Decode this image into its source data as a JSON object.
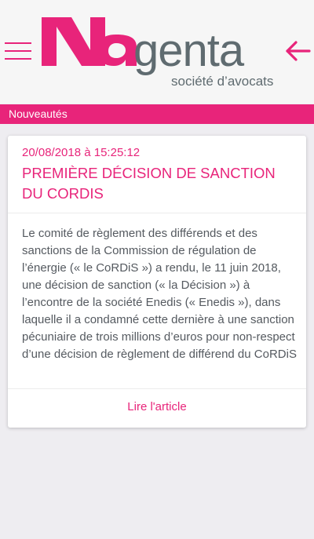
{
  "header": {
    "logo_text": "Magenta",
    "tagline": "société d’avocats"
  },
  "section": {
    "title": "Nouveautés"
  },
  "article": {
    "date": "20/08/2018 à 15:25:12",
    "title": "PREMIÈRE DÉCISION DE SANCTION DU CORDIS",
    "body": "Le comité de règlement des différends et des sanctions de la Commission de régulation de l’énergie (« le CoRDiS ») a rendu, le 11 juin 2018, une décision de sanction (« la Décision ») à l’encontre de la société Enedis (« Enedis »), dans laquelle il a condamné cette dernière à une sanction pécuniaire de trois millions d’euros pour non-respect d’une décision de règlement de différend du CoRDiS",
    "link_label": "Lire l'article"
  },
  "colors": {
    "accent": "#e8247a",
    "logo_grey": "#5f6b70",
    "body_text": "#555a60",
    "background": "#eeedf1"
  },
  "icons": {
    "menu": "hamburger-menu-icon",
    "back": "arrow-left-icon"
  }
}
